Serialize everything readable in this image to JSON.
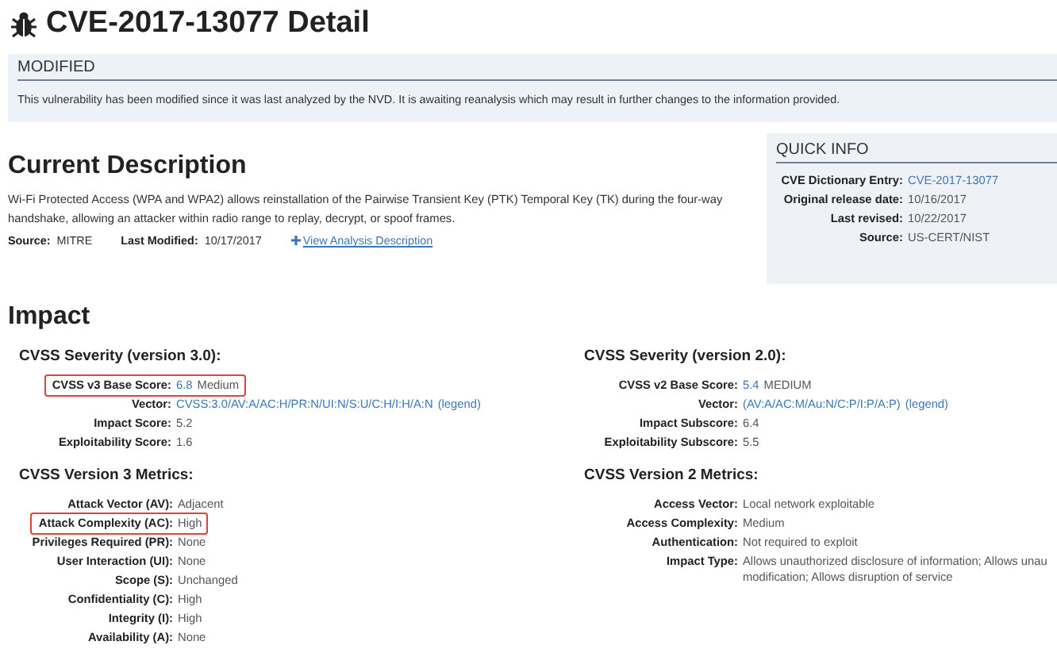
{
  "page_title": "CVE-2017-13077 Detail",
  "banner": {
    "heading": "MODIFIED",
    "text": "This vulnerability has been modified since it was last analyzed by the NVD. It is awaiting reanalysis which may result in further changes to the information provided."
  },
  "description": {
    "heading": "Current Description",
    "text": "Wi-Fi Protected Access (WPA and WPA2) allows reinstallation of the Pairwise Transient Key (PTK) Temporal Key (TK) during the four-way handshake, allowing an attacker within radio range to replay, decrypt, or spoof frames.",
    "source_label": "Source:",
    "source": "MITRE",
    "modified_label": "Last Modified:",
    "modified": "10/17/2017",
    "analysis_link": "View Analysis Description"
  },
  "quick_info": {
    "heading": "QUICK INFO",
    "rows": [
      {
        "label": "CVE Dictionary Entry:",
        "parts": [
          {
            "kind": "link",
            "text": "CVE-2017-13077"
          }
        ]
      },
      {
        "label": "Original release date:",
        "parts": [
          {
            "kind": "text",
            "text": "10/16/2017"
          }
        ]
      },
      {
        "label": "Last revised:",
        "parts": [
          {
            "kind": "text",
            "text": "10/22/2017"
          }
        ]
      },
      {
        "label": "Source:",
        "parts": [
          {
            "kind": "text",
            "text": "US-CERT/NIST"
          }
        ]
      }
    ]
  },
  "impact": {
    "heading": "Impact",
    "columns": [
      {
        "sections": [
          {
            "heading": "CVSS Severity (version 3.0):",
            "rows": [
              {
                "label": "CVSS v3 Base Score:",
                "highlighted": true,
                "parts": [
                  {
                    "kind": "link",
                    "text": "6.8"
                  },
                  {
                    "kind": "text",
                    "text": "Medium"
                  }
                ]
              },
              {
                "label": "Vector:",
                "highlighted": false,
                "parts": [
                  {
                    "kind": "link",
                    "text": "CVSS:3.0/AV:A/AC:H/PR:N/UI:N/S:U/C:H/I:H/A:N"
                  },
                  {
                    "kind": "link",
                    "text": "(legend)"
                  }
                ]
              },
              {
                "label": "Impact Score:",
                "highlighted": false,
                "parts": [
                  {
                    "kind": "text",
                    "text": "5.2"
                  }
                ]
              },
              {
                "label": "Exploitability Score:",
                "highlighted": false,
                "parts": [
                  {
                    "kind": "text",
                    "text": "1.6"
                  }
                ]
              }
            ]
          },
          {
            "heading": "CVSS Version 3 Metrics:",
            "rows": [
              {
                "label": "Attack Vector (AV):",
                "highlighted": false,
                "parts": [
                  {
                    "kind": "text",
                    "text": "Adjacent"
                  }
                ]
              },
              {
                "label": "Attack Complexity (AC):",
                "highlighted": true,
                "parts": [
                  {
                    "kind": "text",
                    "text": "High"
                  }
                ]
              },
              {
                "label": "Privileges Required (PR):",
                "highlighted": false,
                "parts": [
                  {
                    "kind": "text",
                    "text": "None"
                  }
                ]
              },
              {
                "label": "User Interaction (UI):",
                "highlighted": false,
                "parts": [
                  {
                    "kind": "text",
                    "text": "None"
                  }
                ]
              },
              {
                "label": "Scope (S):",
                "highlighted": false,
                "parts": [
                  {
                    "kind": "text",
                    "text": "Unchanged"
                  }
                ]
              },
              {
                "label": "Confidentiality (C):",
                "highlighted": false,
                "parts": [
                  {
                    "kind": "text",
                    "text": "High"
                  }
                ]
              },
              {
                "label": "Integrity (I):",
                "highlighted": false,
                "parts": [
                  {
                    "kind": "text",
                    "text": "High"
                  }
                ]
              },
              {
                "label": "Availability (A):",
                "highlighted": false,
                "parts": [
                  {
                    "kind": "text",
                    "text": "None"
                  }
                ]
              }
            ]
          }
        ]
      },
      {
        "sections": [
          {
            "heading": "CVSS Severity (version 2.0):",
            "rows": [
              {
                "label": "CVSS v2 Base Score:",
                "highlighted": false,
                "parts": [
                  {
                    "kind": "link",
                    "text": "5.4"
                  },
                  {
                    "kind": "text",
                    "text": "MEDIUM"
                  }
                ]
              },
              {
                "label": "Vector:",
                "highlighted": false,
                "parts": [
                  {
                    "kind": "link",
                    "text": "(AV:A/AC:M/Au:N/C:P/I:P/A:P)"
                  },
                  {
                    "kind": "link",
                    "text": "(legend)"
                  }
                ]
              },
              {
                "label": "Impact Subscore:",
                "highlighted": false,
                "parts": [
                  {
                    "kind": "text",
                    "text": "6.4"
                  }
                ]
              },
              {
                "label": "Exploitability Subscore:",
                "highlighted": false,
                "parts": [
                  {
                    "kind": "text",
                    "text": "5.5"
                  }
                ]
              }
            ]
          },
          {
            "heading": "CVSS Version 2 Metrics:",
            "rows": [
              {
                "label": "Access Vector:",
                "highlighted": false,
                "parts": [
                  {
                    "kind": "text",
                    "text": "Local network exploitable"
                  }
                ]
              },
              {
                "label": "Access Complexity:",
                "highlighted": false,
                "parts": [
                  {
                    "kind": "text",
                    "text": "Medium"
                  }
                ]
              },
              {
                "label": "Authentication:",
                "highlighted": false,
                "parts": [
                  {
                    "kind": "text",
                    "text": "Not required to exploit"
                  }
                ]
              },
              {
                "label": "Impact Type:",
                "highlighted": false,
                "parts": [
                  {
                    "kind": "lines",
                    "lines": [
                      "Allows unauthorized disclosure of information; Allows unau",
                      "modification; Allows disruption of service"
                    ]
                  }
                ]
              }
            ]
          }
        ]
      }
    ]
  }
}
